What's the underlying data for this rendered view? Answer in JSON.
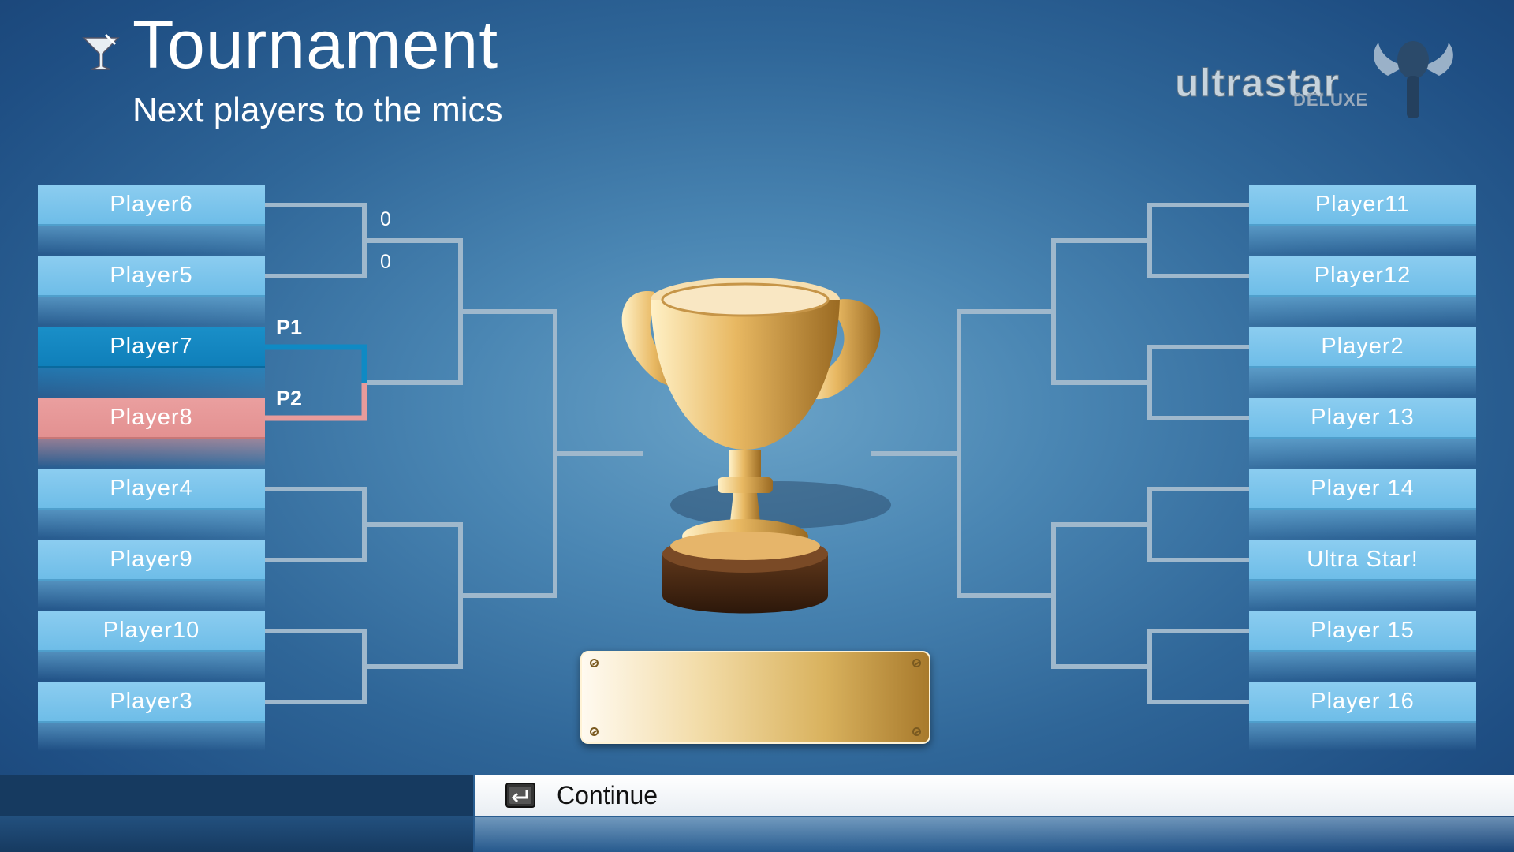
{
  "header": {
    "title": "Tournament",
    "subtitle": "Next players to the mics",
    "title_icon": "cocktail-glass-icon"
  },
  "logo": {
    "main": "ultrastar",
    "sub": "DELUXE"
  },
  "bracket": {
    "left": [
      "Player6",
      "Player5",
      "Player7",
      "Player8",
      "Player4",
      "Player9",
      "Player10",
      "Player3"
    ],
    "right": [
      "Player11",
      "Player12",
      "Player2",
      "Player 13",
      "Player 14",
      "Ultra Star!",
      "Player 15",
      "Player 16"
    ],
    "current_match": {
      "p1_label": "P1",
      "p2_label": "P2",
      "p1_player": "Player7",
      "p2_player": "Player8"
    },
    "scores": [
      "0",
      "0"
    ]
  },
  "colors": {
    "p1": "#0f8ac4",
    "p2": "#e89b9b",
    "slot": "#7fc7ee",
    "bracket_line": "#9fb8cc"
  },
  "footer": {
    "continue_label": "Continue",
    "continue_icon": "enter-key-icon"
  }
}
